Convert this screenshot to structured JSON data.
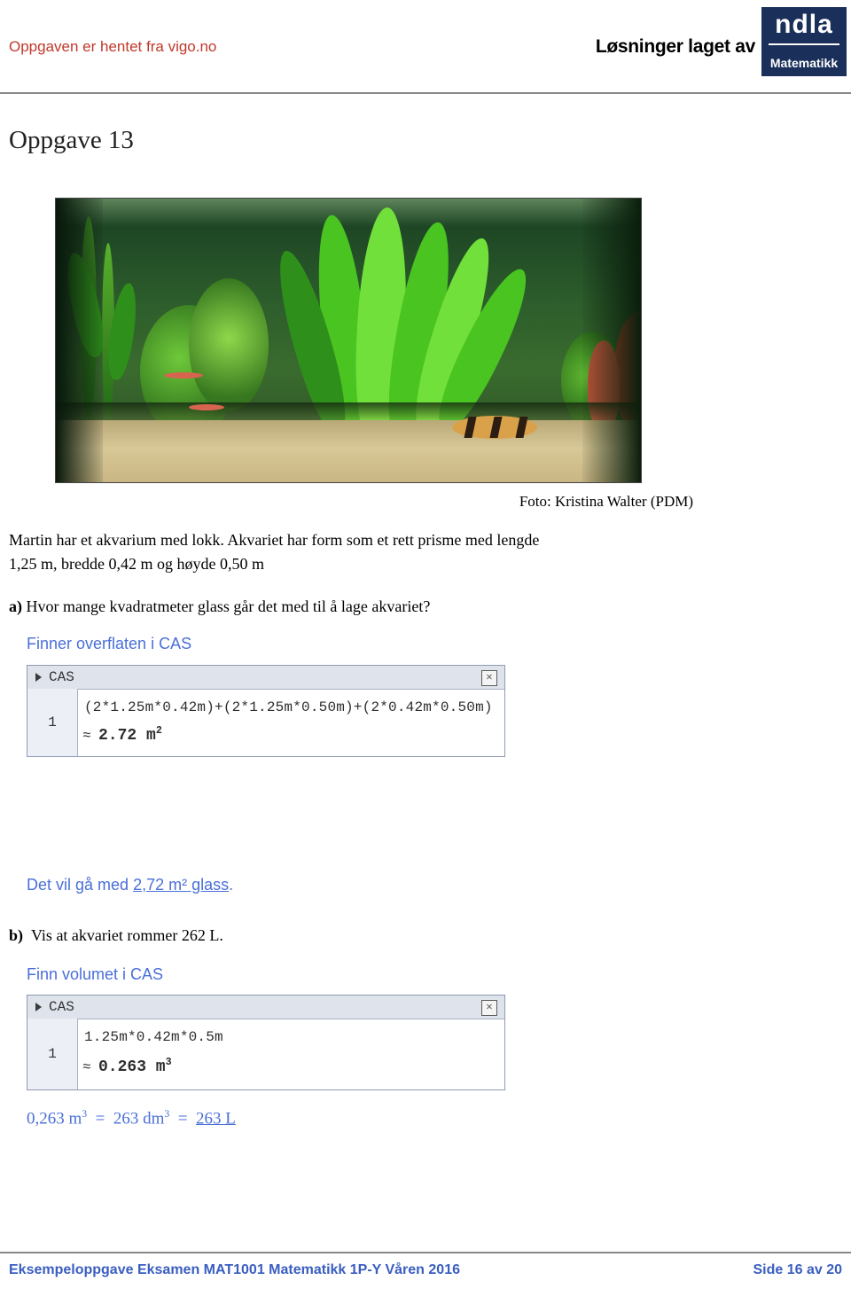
{
  "header": {
    "source_note": "Oppgaven er hentet fra vigo.no",
    "made_by": "Løsninger laget av",
    "logo_word": "ndla",
    "logo_sub": "Matematikk"
  },
  "document": {
    "title": "Oppgave 13",
    "photo_credit": "Foto: Kristina Walter (PDM)",
    "intro_line1": "Martin har et akvarium med lokk.  Akvariet har form som et rett prisme med lengde",
    "intro_line2": "1,25 m, bredde 0,42 m og høyde 0,50 m",
    "task_a_label": "a)",
    "task_a_text": "Hvor mange kvadratmeter glass går det med til å lage akvariet?",
    "task_a_hint": "Finner overflaten i CAS",
    "task_a_result_prefix": "Det vil gå med ",
    "task_a_result_value": "2,72 m² glass",
    "task_a_result_suffix": ".",
    "task_b_label": "b)",
    "task_b_text": "Vis at akvariet rommer 262 L.",
    "task_b_hint": "Finn volumet i CAS",
    "final_line": "0,263 m³ = 263 dm³ = 263 L",
    "final_underlined": "263 L"
  },
  "cas_a": {
    "panel_label": "CAS",
    "row_number": "1",
    "input": "(2*1.25m*0.42m)+(2*1.25m*0.50m)+(2*0.42m*0.50m)",
    "approx_symbol": "≈",
    "output": "2.72 m",
    "output_exponent": "2",
    "close_icon": "✕"
  },
  "cas_b": {
    "panel_label": "CAS",
    "row_number": "1",
    "input": "1.25m*0.42m*0.5m",
    "approx_symbol": "≈",
    "output": "0.263 m",
    "output_exponent": "3",
    "close_icon": "✕"
  },
  "footer": {
    "left": "Eksempeloppgave Eksamen MAT1001 Matematikk 1P-Y Våren 2016",
    "right": "Side 16 av 20"
  },
  "colors": {
    "solution_blue": "#4a6fd8",
    "footer_blue": "#3a5ec0",
    "source_red": "#c0392b",
    "logo_navy": "#1a2f5a"
  }
}
